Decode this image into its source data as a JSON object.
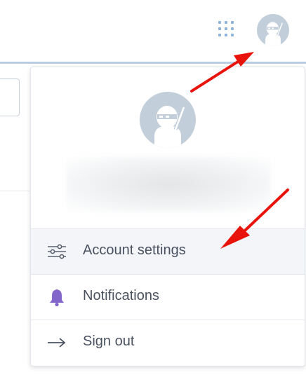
{
  "header": {
    "apps_icon": "grid-dots-icon",
    "avatar_icon": "ninja-avatar-icon"
  },
  "user_menu": {
    "avatar_icon": "ninja-avatar-icon",
    "items": [
      {
        "label": "Account settings",
        "icon": "sliders-icon",
        "highlighted": true
      },
      {
        "label": "Notifications",
        "icon": "bell-icon"
      },
      {
        "label": "Sign out",
        "icon": "arrow-right-icon"
      }
    ]
  },
  "colors": {
    "avatar_bg": "#c3cedb",
    "accent_purple": "#8366c9",
    "annotation_red": "#e8140b"
  }
}
